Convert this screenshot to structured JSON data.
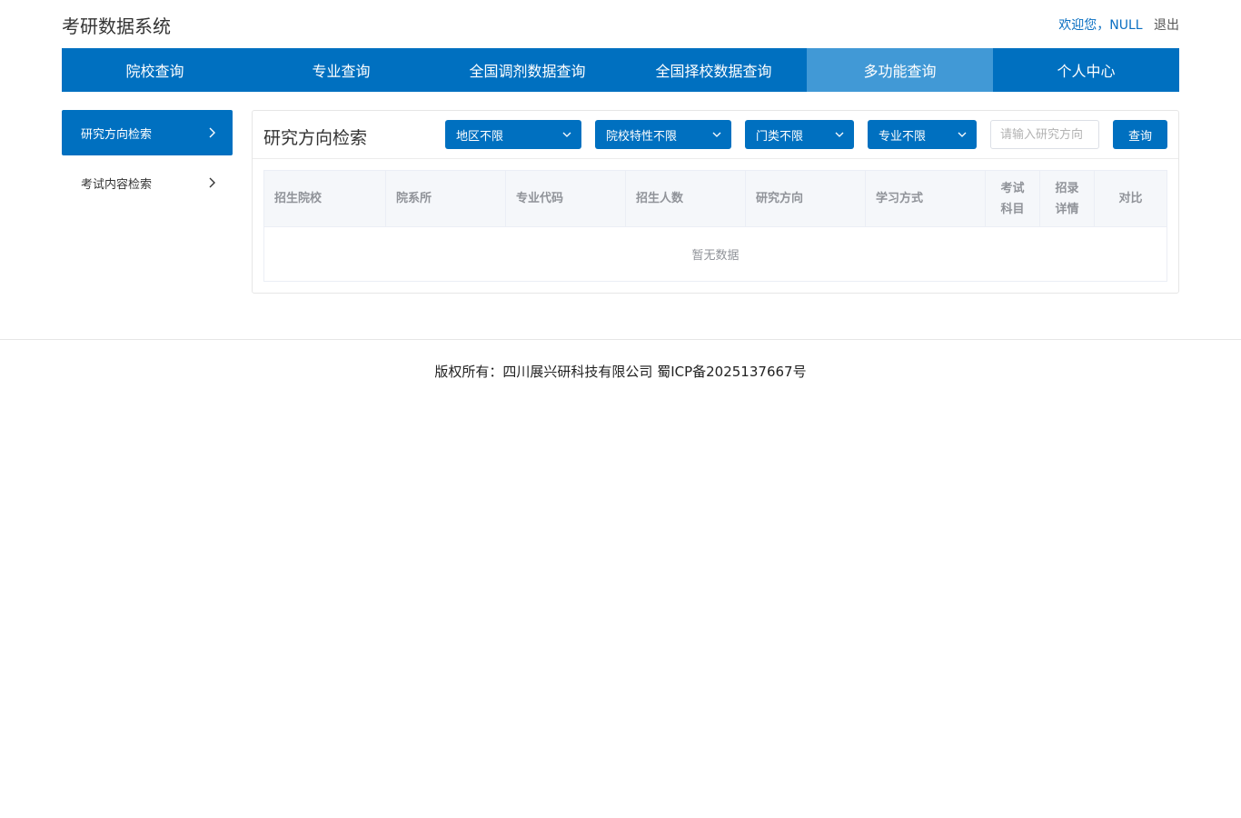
{
  "header": {
    "site_title": "考研数据系统",
    "welcome": "欢迎您，NULL",
    "logout": "退出"
  },
  "nav": {
    "items": [
      {
        "label": "院校查询"
      },
      {
        "label": "专业查询"
      },
      {
        "label": "全国调剂数据查询"
      },
      {
        "label": "全国择校数据查询"
      },
      {
        "label": "多功能查询"
      },
      {
        "label": "个人中心"
      }
    ],
    "active_index": 4
  },
  "sidebar": {
    "items": [
      {
        "label": "研究方向检索",
        "icon": "chevron-right-icon"
      },
      {
        "label": "考试内容检索",
        "icon": "chevron-right-icon"
      }
    ]
  },
  "panel": {
    "title": "研究方向检索",
    "filters": [
      {
        "label": "地区不限"
      },
      {
        "label": "院校特性不限"
      },
      {
        "label": "门类不限"
      },
      {
        "label": "专业不限"
      }
    ],
    "search_placeholder": "请输入研究方向",
    "search_value": "",
    "query_label": "查询"
  },
  "table": {
    "columns": [
      "招生院校",
      "院系所",
      "专业代码",
      "招生人数",
      "研究方向",
      "学习方式",
      "考试科目",
      "招录详情",
      "对比"
    ],
    "empty_text": "暂无数据"
  },
  "footer": {
    "text": "版权所有：四川展兴研科技有限公司 蜀ICP备2025137667号"
  },
  "colors": {
    "primary": "#0070c0",
    "nav_active": "#4199d6"
  }
}
